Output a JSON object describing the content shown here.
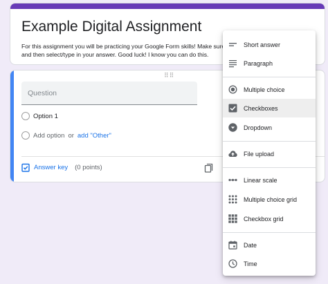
{
  "form": {
    "title": "Example Digital Assignment",
    "description": "For this assignment you will be practicing your Google Form skills!  Make sure and then select/type in your answer.  Good luck! I know you can do this."
  },
  "question": {
    "placeholder": "Question",
    "option1": "Option 1",
    "add_option": "Add option",
    "or": "or",
    "add_other": "add \"Other\"",
    "answer_key": "Answer key",
    "points": "(0 points)"
  },
  "menu": {
    "items": [
      {
        "label": "Short answer",
        "icon": "short-answer-icon"
      },
      {
        "label": "Paragraph",
        "icon": "paragraph-icon"
      },
      {
        "label": "Multiple choice",
        "icon": "radio-button-icon"
      },
      {
        "label": "Checkboxes",
        "icon": "checkbox-icon",
        "selected": true
      },
      {
        "label": "Dropdown",
        "icon": "dropdown-icon"
      },
      {
        "label": "File upload",
        "icon": "cloud-upload-icon"
      },
      {
        "label": "Linear scale",
        "icon": "linear-scale-icon"
      },
      {
        "label": "Multiple choice grid",
        "icon": "grid-icon"
      },
      {
        "label": "Checkbox grid",
        "icon": "grid-icon"
      },
      {
        "label": "Date",
        "icon": "calendar-icon"
      },
      {
        "label": "Time",
        "icon": "clock-icon"
      }
    ]
  },
  "colors": {
    "theme": "#673ab7",
    "accent": "#4285f4",
    "link": "#1a73e8",
    "background": "#f0ebf8"
  }
}
